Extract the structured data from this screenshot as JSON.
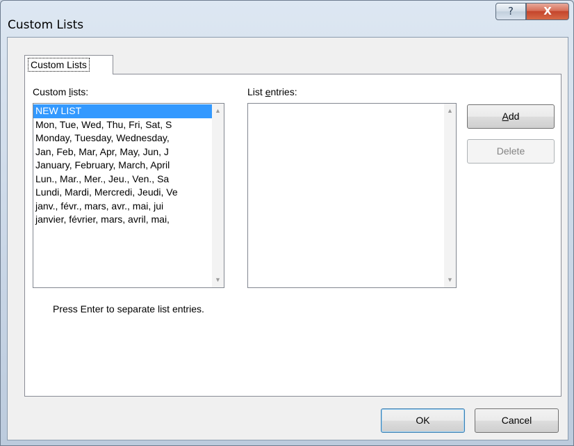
{
  "window": {
    "title": "Custom Lists",
    "help_glyph": "?",
    "close_glyph": "X"
  },
  "tabs": [
    {
      "label": "Custom Lists"
    }
  ],
  "custom_lists": {
    "label_prefix": "Custom ",
    "label_accel": "l",
    "label_suffix": "ists:",
    "items": [
      "NEW LIST",
      "Mon, Tue, Wed, Thu, Fri, Sat, S",
      "Monday, Tuesday, Wednesday,",
      "Jan, Feb, Mar, Apr, May, Jun, J",
      "January, February, March, April",
      "Lun., Mar., Mer., Jeu., Ven., Sa",
      "Lundi, Mardi, Mercredi, Jeudi, Ve",
      "janv., févr., mars, avr., mai, jui",
      "janvier, février, mars, avril, mai,"
    ],
    "selected_index": 0
  },
  "list_entries": {
    "label_prefix": "List ",
    "label_accel": "e",
    "label_suffix": "ntries:",
    "value": ""
  },
  "buttons": {
    "add_accel": "A",
    "add_rest": "dd",
    "delete": "Delete",
    "ok": "OK",
    "cancel": "Cancel"
  },
  "hint": "Press Enter to separate list entries.",
  "icons": {
    "scroll_up": "▲",
    "scroll_down": "▼"
  }
}
